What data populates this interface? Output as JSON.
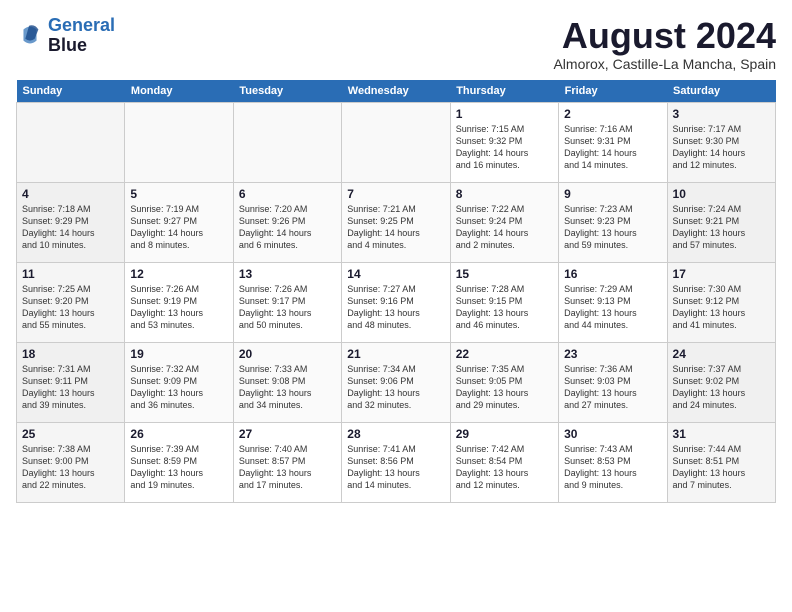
{
  "header": {
    "logo_line1": "General",
    "logo_line2": "Blue",
    "month_year": "August 2024",
    "location": "Almorox, Castille-La Mancha, Spain"
  },
  "weekdays": [
    "Sunday",
    "Monday",
    "Tuesday",
    "Wednesday",
    "Thursday",
    "Friday",
    "Saturday"
  ],
  "weeks": [
    [
      {
        "day": "",
        "info": ""
      },
      {
        "day": "",
        "info": ""
      },
      {
        "day": "",
        "info": ""
      },
      {
        "day": "",
        "info": ""
      },
      {
        "day": "1",
        "info": "Sunrise: 7:15 AM\nSunset: 9:32 PM\nDaylight: 14 hours\nand 16 minutes."
      },
      {
        "day": "2",
        "info": "Sunrise: 7:16 AM\nSunset: 9:31 PM\nDaylight: 14 hours\nand 14 minutes."
      },
      {
        "day": "3",
        "info": "Sunrise: 7:17 AM\nSunset: 9:30 PM\nDaylight: 14 hours\nand 12 minutes."
      }
    ],
    [
      {
        "day": "4",
        "info": "Sunrise: 7:18 AM\nSunset: 9:29 PM\nDaylight: 14 hours\nand 10 minutes."
      },
      {
        "day": "5",
        "info": "Sunrise: 7:19 AM\nSunset: 9:27 PM\nDaylight: 14 hours\nand 8 minutes."
      },
      {
        "day": "6",
        "info": "Sunrise: 7:20 AM\nSunset: 9:26 PM\nDaylight: 14 hours\nand 6 minutes."
      },
      {
        "day": "7",
        "info": "Sunrise: 7:21 AM\nSunset: 9:25 PM\nDaylight: 14 hours\nand 4 minutes."
      },
      {
        "day": "8",
        "info": "Sunrise: 7:22 AM\nSunset: 9:24 PM\nDaylight: 14 hours\nand 2 minutes."
      },
      {
        "day": "9",
        "info": "Sunrise: 7:23 AM\nSunset: 9:23 PM\nDaylight: 13 hours\nand 59 minutes."
      },
      {
        "day": "10",
        "info": "Sunrise: 7:24 AM\nSunset: 9:21 PM\nDaylight: 13 hours\nand 57 minutes."
      }
    ],
    [
      {
        "day": "11",
        "info": "Sunrise: 7:25 AM\nSunset: 9:20 PM\nDaylight: 13 hours\nand 55 minutes."
      },
      {
        "day": "12",
        "info": "Sunrise: 7:26 AM\nSunset: 9:19 PM\nDaylight: 13 hours\nand 53 minutes."
      },
      {
        "day": "13",
        "info": "Sunrise: 7:26 AM\nSunset: 9:17 PM\nDaylight: 13 hours\nand 50 minutes."
      },
      {
        "day": "14",
        "info": "Sunrise: 7:27 AM\nSunset: 9:16 PM\nDaylight: 13 hours\nand 48 minutes."
      },
      {
        "day": "15",
        "info": "Sunrise: 7:28 AM\nSunset: 9:15 PM\nDaylight: 13 hours\nand 46 minutes."
      },
      {
        "day": "16",
        "info": "Sunrise: 7:29 AM\nSunset: 9:13 PM\nDaylight: 13 hours\nand 44 minutes."
      },
      {
        "day": "17",
        "info": "Sunrise: 7:30 AM\nSunset: 9:12 PM\nDaylight: 13 hours\nand 41 minutes."
      }
    ],
    [
      {
        "day": "18",
        "info": "Sunrise: 7:31 AM\nSunset: 9:11 PM\nDaylight: 13 hours\nand 39 minutes."
      },
      {
        "day": "19",
        "info": "Sunrise: 7:32 AM\nSunset: 9:09 PM\nDaylight: 13 hours\nand 36 minutes."
      },
      {
        "day": "20",
        "info": "Sunrise: 7:33 AM\nSunset: 9:08 PM\nDaylight: 13 hours\nand 34 minutes."
      },
      {
        "day": "21",
        "info": "Sunrise: 7:34 AM\nSunset: 9:06 PM\nDaylight: 13 hours\nand 32 minutes."
      },
      {
        "day": "22",
        "info": "Sunrise: 7:35 AM\nSunset: 9:05 PM\nDaylight: 13 hours\nand 29 minutes."
      },
      {
        "day": "23",
        "info": "Sunrise: 7:36 AM\nSunset: 9:03 PM\nDaylight: 13 hours\nand 27 minutes."
      },
      {
        "day": "24",
        "info": "Sunrise: 7:37 AM\nSunset: 9:02 PM\nDaylight: 13 hours\nand 24 minutes."
      }
    ],
    [
      {
        "day": "25",
        "info": "Sunrise: 7:38 AM\nSunset: 9:00 PM\nDaylight: 13 hours\nand 22 minutes."
      },
      {
        "day": "26",
        "info": "Sunrise: 7:39 AM\nSunset: 8:59 PM\nDaylight: 13 hours\nand 19 minutes."
      },
      {
        "day": "27",
        "info": "Sunrise: 7:40 AM\nSunset: 8:57 PM\nDaylight: 13 hours\nand 17 minutes."
      },
      {
        "day": "28",
        "info": "Sunrise: 7:41 AM\nSunset: 8:56 PM\nDaylight: 13 hours\nand 14 minutes."
      },
      {
        "day": "29",
        "info": "Sunrise: 7:42 AM\nSunset: 8:54 PM\nDaylight: 13 hours\nand 12 minutes."
      },
      {
        "day": "30",
        "info": "Sunrise: 7:43 AM\nSunset: 8:53 PM\nDaylight: 13 hours\nand 9 minutes."
      },
      {
        "day": "31",
        "info": "Sunrise: 7:44 AM\nSunset: 8:51 PM\nDaylight: 13 hours\nand 7 minutes."
      }
    ]
  ]
}
